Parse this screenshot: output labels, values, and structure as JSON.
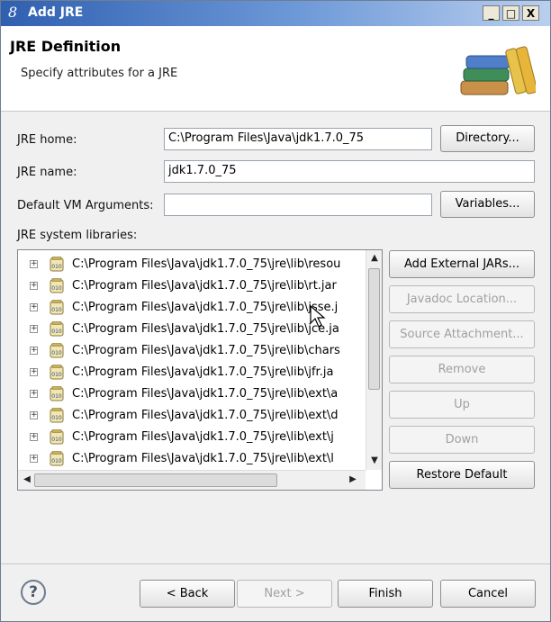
{
  "window": {
    "title": "Add JRE",
    "controls": {
      "minimize": "_",
      "maximize": "□",
      "close": "X"
    }
  },
  "banner": {
    "title": "JRE Definition",
    "subtitle": "Specify attributes for a JRE",
    "icon": "books-icon"
  },
  "form": {
    "jre_home_label": "JRE home:",
    "jre_home_value": "C:\\Program Files\\Java\\jdk1.7.0_75",
    "directory_button": "Directory...",
    "jre_name_label": "JRE name:",
    "jre_name_value": "jdk1.7.0_75",
    "vm_args_label": "Default VM Arguments:",
    "vm_args_value": "",
    "variables_button": "Variables...",
    "libraries_label": "JRE system libraries:"
  },
  "libraries": [
    {
      "path": "C:\\Program Files\\Java\\jdk1.7.0_75\\jre\\lib\\resou"
    },
    {
      "path": "C:\\Program Files\\Java\\jdk1.7.0_75\\jre\\lib\\rt.jar"
    },
    {
      "path": "C:\\Program Files\\Java\\jdk1.7.0_75\\jre\\lib\\jsse.j"
    },
    {
      "path": "C:\\Program Files\\Java\\jdk1.7.0_75\\jre\\lib\\jce.ja"
    },
    {
      "path": "C:\\Program Files\\Java\\jdk1.7.0_75\\jre\\lib\\chars"
    },
    {
      "path": "C:\\Program Files\\Java\\jdk1.7.0_75\\jre\\lib\\jfr.ja"
    },
    {
      "path": "C:\\Program Files\\Java\\jdk1.7.0_75\\jre\\lib\\ext\\a"
    },
    {
      "path": "C:\\Program Files\\Java\\jdk1.7.0_75\\jre\\lib\\ext\\d"
    },
    {
      "path": "C:\\Program Files\\Java\\jdk1.7.0_75\\jre\\lib\\ext\\j"
    },
    {
      "path": "C:\\Program Files\\Java\\jdk1.7.0_75\\jre\\lib\\ext\\l"
    }
  ],
  "side_buttons": {
    "add_external_jars": "Add External JARs...",
    "javadoc_location": "Javadoc Location...",
    "source_attachment": "Source Attachment...",
    "remove": "Remove",
    "up": "Up",
    "down": "Down",
    "restore_default": "Restore Default"
  },
  "footer": {
    "help": "?",
    "back": "< Back",
    "next": "Next >",
    "finish": "Finish",
    "cancel": "Cancel"
  }
}
